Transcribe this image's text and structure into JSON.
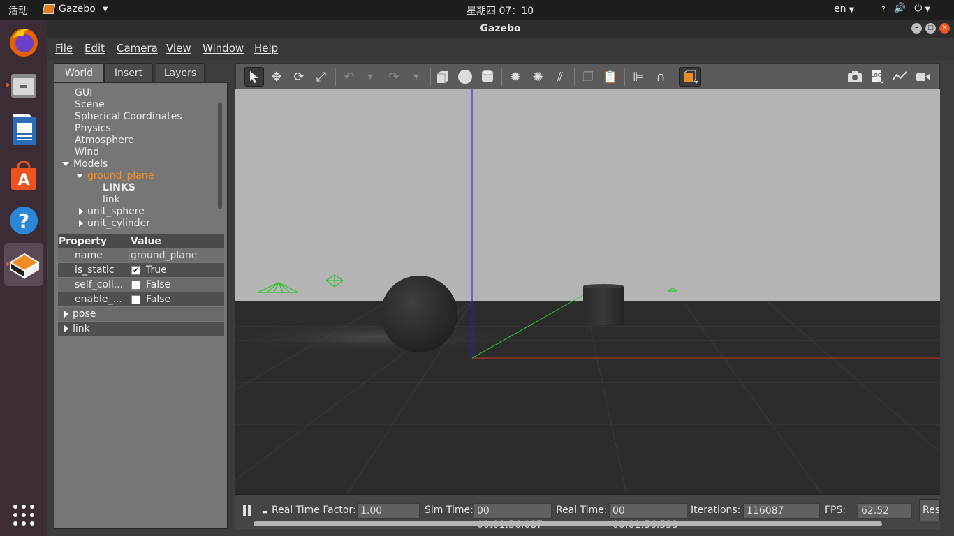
{
  "topbar": {
    "activities": "活动",
    "app_name": "Gazebo",
    "clock": "星期四 07：10",
    "language": "en"
  },
  "dock": {
    "icons": [
      "firefox-icon",
      "files-icon",
      "libreoffice-writer-icon",
      "software-center-icon",
      "help-icon",
      "gazebo-icon",
      "app-grid-icon"
    ]
  },
  "window": {
    "title": "Gazebo"
  },
  "menu": {
    "items": [
      "File",
      "Edit",
      "Camera",
      "View",
      "Window",
      "Help"
    ]
  },
  "left_panel": {
    "tabs": [
      "World",
      "Insert",
      "Layers"
    ],
    "selected_tab": "World",
    "tree": {
      "items": [
        "GUI",
        "Scene",
        "Spherical Coordinates",
        "Physics",
        "Atmosphere",
        "Wind"
      ],
      "models_label": "Models",
      "selected_model": "ground_plane",
      "links_header": "LINKS",
      "link_item": "link",
      "other_models": [
        "unit_sphere",
        "unit_cylinder"
      ]
    },
    "properties": {
      "header_property": "Property",
      "header_value": "Value",
      "rows": [
        {
          "name": "name",
          "value": "ground_plane"
        },
        {
          "name": "is_static",
          "value": "True",
          "checked": true
        },
        {
          "name": "self_coll...",
          "value": "False",
          "checked": false
        },
        {
          "name": "enable_...",
          "value": "False",
          "checked": false
        }
      ],
      "groups": [
        "pose",
        "link"
      ]
    }
  },
  "toolbar": {
    "tools": [
      "select",
      "translate",
      "rotate",
      "scale",
      "undo",
      "redo",
      "box",
      "sphere",
      "cylinder",
      "point-light",
      "spot-light",
      "directional-light",
      "copy",
      "paste",
      "align",
      "snap",
      "view-angle"
    ],
    "right_tools": [
      "screenshot",
      "log",
      "plot",
      "record-video"
    ]
  },
  "status": {
    "real_time_factor_label": "Real Time Factor:",
    "real_time_factor": "1.00",
    "sim_time_label": "Sim Time:",
    "sim_time": "00 00:01:56.087",
    "real_time_label": "Real Time:",
    "real_time": "00 00:01:56.533",
    "iterations_label": "Iterations:",
    "iterations": "116087",
    "fps_label": "FPS:",
    "fps": "62.52",
    "reset_label": "Reset"
  },
  "colors": {
    "selected_orange": "#ff8c1a",
    "sky": "#b4b4b4",
    "ground": "#2c2c2c",
    "axis_blue": "#1a1aff",
    "axis_green": "#22cc22",
    "axis_red": "#cc3322"
  }
}
